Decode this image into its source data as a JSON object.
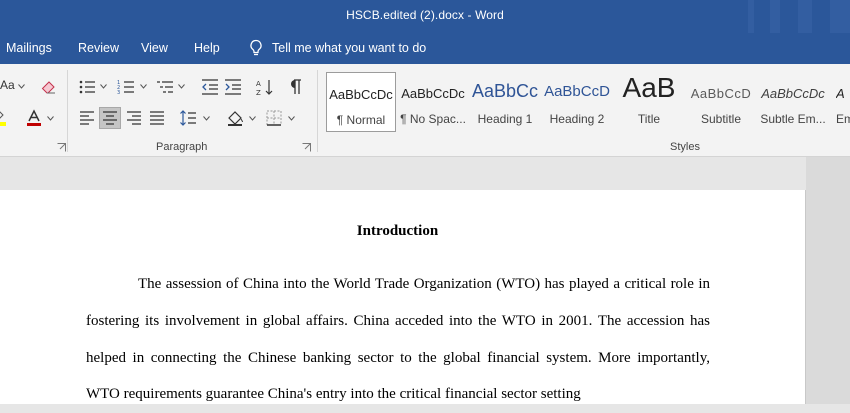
{
  "window": {
    "title": "HSCB.edited (2).docx  -  Word"
  },
  "tabs": [
    "Mailings",
    "Review",
    "View",
    "Help"
  ],
  "tell_me": {
    "label": "Tell me what you want to do"
  },
  "ribbon": {
    "font_group": {
      "clear_format_icon": "eraser-icon",
      "font_color": "#c00000",
      "highlight_color": "#ffff00",
      "change_case_label": "Aa"
    },
    "paragraph_group": {
      "label": "Paragraph"
    },
    "styles_group": {
      "label": "Styles",
      "items": [
        {
          "sample": "AaBbCcDc",
          "name": "¶ Normal"
        },
        {
          "sample": "AaBbCcDc",
          "name": "¶ No Spac..."
        },
        {
          "sample": "AaBbCc",
          "name": "Heading 1"
        },
        {
          "sample": "AaBbCcD",
          "name": "Heading 2"
        },
        {
          "sample": "AaB",
          "name": "Title"
        },
        {
          "sample": "AaBbCcD",
          "name": "Subtitle"
        },
        {
          "sample": "AaBbCcDc",
          "name": "Subtle Em..."
        },
        {
          "sample": "A",
          "name": "Em"
        }
      ]
    }
  },
  "document": {
    "heading": "Introduction",
    "paragraph": "The assession of China into the World Trade Organization (WTO) has played a critical role in fostering its involvement in global affairs. China acceded into the WTO in 2001. The accession has helped in connecting the Chinese banking sector to the global financial system. More importantly, WTO requirements guarantee China's entry into the critical financial sector setting"
  }
}
